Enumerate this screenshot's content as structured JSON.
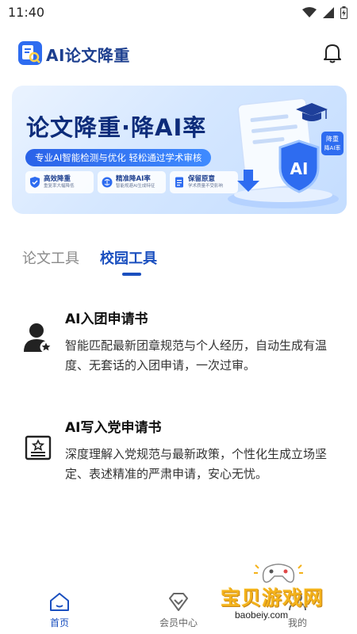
{
  "status_bar": {
    "time": "11:40"
  },
  "header": {
    "app_title": "AI论文降重"
  },
  "banner": {
    "title": "论文降重·降AI率",
    "subtitle": "专业AI智能检测与优化  轻松通过学术审核",
    "features": [
      {
        "title": "高效降重",
        "desc": "重复率大幅降低"
      },
      {
        "title": "精准降AI率",
        "desc": "智能规避AI生成特征"
      },
      {
        "title": "保留原意",
        "desc": "学术质量不受影响"
      }
    ],
    "badge_text": "降重 降AI率",
    "shield_text": "AI"
  },
  "tabs": [
    {
      "label": "论文工具",
      "active": false
    },
    {
      "label": "校园工具",
      "active": true
    }
  ],
  "tools": [
    {
      "title": "AI入团申请书",
      "desc": "智能匹配最新团章规范与个人经历，自动生成有温度、无套话的入团申请，一次过审。",
      "icon": "user-star-icon"
    },
    {
      "title": "AI写入党申请书",
      "desc": "深度理解入党规范与最新政策，个性化生成立场坚定、表述精准的严肃申请，安心无忧。",
      "icon": "certificate-star-icon"
    }
  ],
  "bottom_nav": [
    {
      "label": "首页",
      "icon": "home-icon",
      "active": true
    },
    {
      "label": "会员中心",
      "icon": "diamond-icon",
      "active": false
    },
    {
      "label": "我的",
      "icon": "user-icon",
      "active": false
    }
  ],
  "watermark": {
    "text": "宝贝游戏网",
    "url": "baobeiy.com"
  },
  "colors": {
    "primary": "#1a4fbf",
    "title_dark": "#1d3f8f",
    "banner_bg": "#d5e7ff",
    "watermark": "#f4b21a"
  }
}
